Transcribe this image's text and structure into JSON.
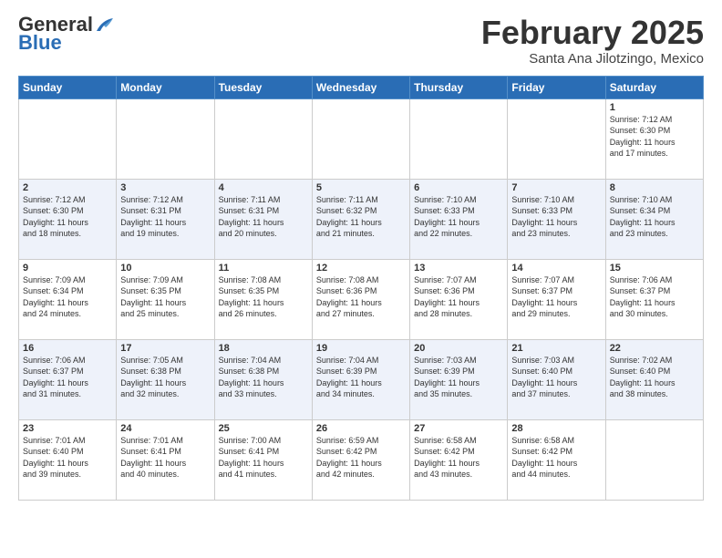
{
  "header": {
    "logo_general": "General",
    "logo_blue": "Blue",
    "month_title": "February 2025",
    "location": "Santa Ana Jilotzingo, Mexico"
  },
  "days_of_week": [
    "Sunday",
    "Monday",
    "Tuesday",
    "Wednesday",
    "Thursday",
    "Friday",
    "Saturday"
  ],
  "weeks": [
    [
      {
        "day": "",
        "info": ""
      },
      {
        "day": "",
        "info": ""
      },
      {
        "day": "",
        "info": ""
      },
      {
        "day": "",
        "info": ""
      },
      {
        "day": "",
        "info": ""
      },
      {
        "day": "",
        "info": ""
      },
      {
        "day": "1",
        "info": "Sunrise: 7:12 AM\nSunset: 6:30 PM\nDaylight: 11 hours\nand 17 minutes."
      }
    ],
    [
      {
        "day": "2",
        "info": "Sunrise: 7:12 AM\nSunset: 6:30 PM\nDaylight: 11 hours\nand 18 minutes."
      },
      {
        "day": "3",
        "info": "Sunrise: 7:12 AM\nSunset: 6:31 PM\nDaylight: 11 hours\nand 19 minutes."
      },
      {
        "day": "4",
        "info": "Sunrise: 7:11 AM\nSunset: 6:31 PM\nDaylight: 11 hours\nand 20 minutes."
      },
      {
        "day": "5",
        "info": "Sunrise: 7:11 AM\nSunset: 6:32 PM\nDaylight: 11 hours\nand 21 minutes."
      },
      {
        "day": "6",
        "info": "Sunrise: 7:10 AM\nSunset: 6:33 PM\nDaylight: 11 hours\nand 22 minutes."
      },
      {
        "day": "7",
        "info": "Sunrise: 7:10 AM\nSunset: 6:33 PM\nDaylight: 11 hours\nand 23 minutes."
      },
      {
        "day": "8",
        "info": "Sunrise: 7:10 AM\nSunset: 6:34 PM\nDaylight: 11 hours\nand 23 minutes."
      }
    ],
    [
      {
        "day": "9",
        "info": "Sunrise: 7:09 AM\nSunset: 6:34 PM\nDaylight: 11 hours\nand 24 minutes."
      },
      {
        "day": "10",
        "info": "Sunrise: 7:09 AM\nSunset: 6:35 PM\nDaylight: 11 hours\nand 25 minutes."
      },
      {
        "day": "11",
        "info": "Sunrise: 7:08 AM\nSunset: 6:35 PM\nDaylight: 11 hours\nand 26 minutes."
      },
      {
        "day": "12",
        "info": "Sunrise: 7:08 AM\nSunset: 6:36 PM\nDaylight: 11 hours\nand 27 minutes."
      },
      {
        "day": "13",
        "info": "Sunrise: 7:07 AM\nSunset: 6:36 PM\nDaylight: 11 hours\nand 28 minutes."
      },
      {
        "day": "14",
        "info": "Sunrise: 7:07 AM\nSunset: 6:37 PM\nDaylight: 11 hours\nand 29 minutes."
      },
      {
        "day": "15",
        "info": "Sunrise: 7:06 AM\nSunset: 6:37 PM\nDaylight: 11 hours\nand 30 minutes."
      }
    ],
    [
      {
        "day": "16",
        "info": "Sunrise: 7:06 AM\nSunset: 6:37 PM\nDaylight: 11 hours\nand 31 minutes."
      },
      {
        "day": "17",
        "info": "Sunrise: 7:05 AM\nSunset: 6:38 PM\nDaylight: 11 hours\nand 32 minutes."
      },
      {
        "day": "18",
        "info": "Sunrise: 7:04 AM\nSunset: 6:38 PM\nDaylight: 11 hours\nand 33 minutes."
      },
      {
        "day": "19",
        "info": "Sunrise: 7:04 AM\nSunset: 6:39 PM\nDaylight: 11 hours\nand 34 minutes."
      },
      {
        "day": "20",
        "info": "Sunrise: 7:03 AM\nSunset: 6:39 PM\nDaylight: 11 hours\nand 35 minutes."
      },
      {
        "day": "21",
        "info": "Sunrise: 7:03 AM\nSunset: 6:40 PM\nDaylight: 11 hours\nand 37 minutes."
      },
      {
        "day": "22",
        "info": "Sunrise: 7:02 AM\nSunset: 6:40 PM\nDaylight: 11 hours\nand 38 minutes."
      }
    ],
    [
      {
        "day": "23",
        "info": "Sunrise: 7:01 AM\nSunset: 6:40 PM\nDaylight: 11 hours\nand 39 minutes."
      },
      {
        "day": "24",
        "info": "Sunrise: 7:01 AM\nSunset: 6:41 PM\nDaylight: 11 hours\nand 40 minutes."
      },
      {
        "day": "25",
        "info": "Sunrise: 7:00 AM\nSunset: 6:41 PM\nDaylight: 11 hours\nand 41 minutes."
      },
      {
        "day": "26",
        "info": "Sunrise: 6:59 AM\nSunset: 6:42 PM\nDaylight: 11 hours\nand 42 minutes."
      },
      {
        "day": "27",
        "info": "Sunrise: 6:58 AM\nSunset: 6:42 PM\nDaylight: 11 hours\nand 43 minutes."
      },
      {
        "day": "28",
        "info": "Sunrise: 6:58 AM\nSunset: 6:42 PM\nDaylight: 11 hours\nand 44 minutes."
      },
      {
        "day": "",
        "info": ""
      }
    ]
  ]
}
